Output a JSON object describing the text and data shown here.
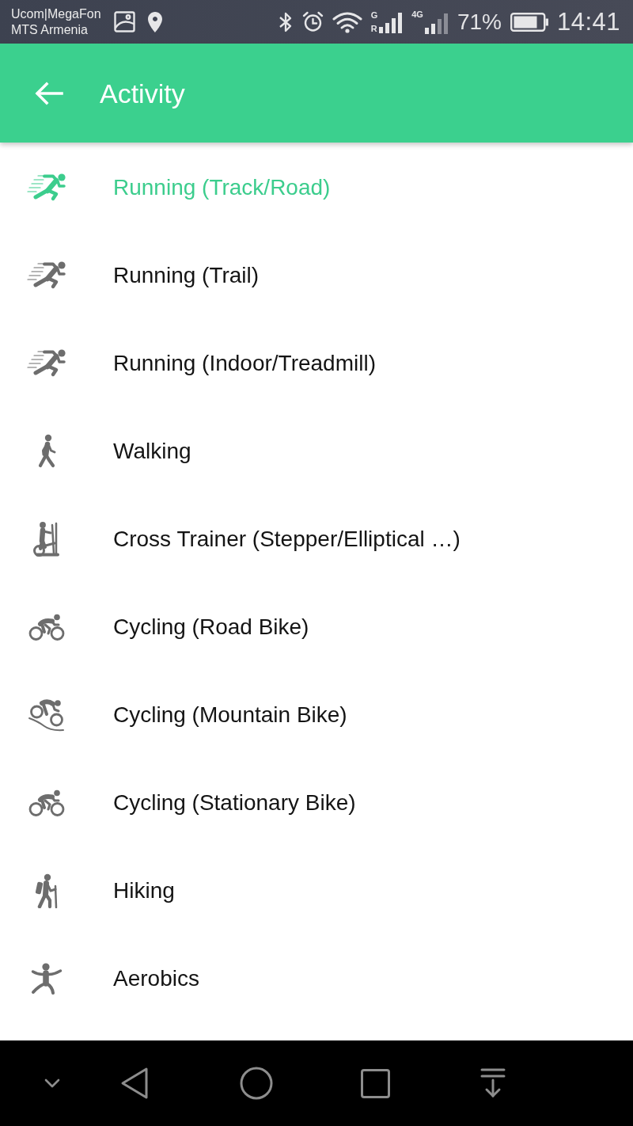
{
  "status_bar": {
    "carrier_lines": [
      "Ucom|MegaFon",
      "MTS Armenia"
    ],
    "sim_1": {
      "network": "G",
      "roaming": "R"
    },
    "sim_2": {
      "network": "4G"
    },
    "battery": "71%",
    "time": "14:41"
  },
  "app_bar": {
    "title": "Activity"
  },
  "activities": [
    {
      "kind": "running",
      "label": "Running (Track/Road)",
      "selected": true
    },
    {
      "kind": "running",
      "label": "Running (Trail)",
      "selected": false
    },
    {
      "kind": "running",
      "label": "Running (Indoor/Treadmill)",
      "selected": false
    },
    {
      "kind": "walking",
      "label": "Walking",
      "selected": false
    },
    {
      "kind": "elliptical",
      "label": "Cross Trainer (Stepper/Elliptical …)",
      "selected": false
    },
    {
      "kind": "cycling",
      "label": "Cycling (Road Bike)",
      "selected": false
    },
    {
      "kind": "mountain_biking",
      "label": "Cycling (Mountain Bike)",
      "selected": false
    },
    {
      "kind": "cycling",
      "label": "Cycling (Stationary Bike)",
      "selected": false
    },
    {
      "kind": "hiking",
      "label": "Hiking",
      "selected": false
    },
    {
      "kind": "aerobics",
      "label": "Aerobics",
      "selected": false
    }
  ]
}
